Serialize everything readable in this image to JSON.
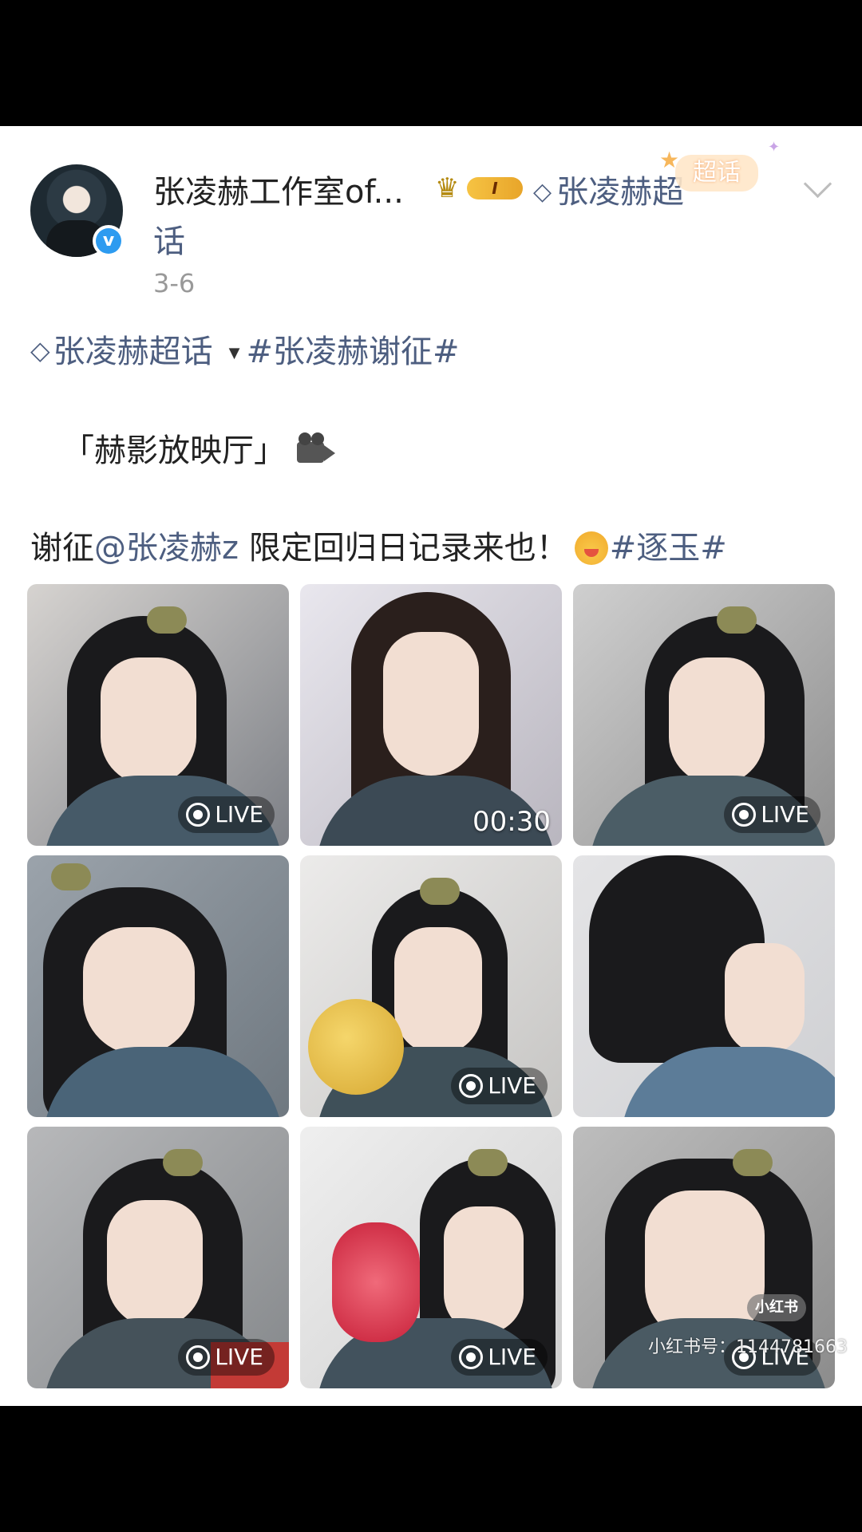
{
  "post": {
    "username_line1": "张凌赫工作室of...",
    "vip_level": "I",
    "supertopic_tag": "张凌赫超",
    "username_line2": "话",
    "sticker_text": "超话",
    "date": "3-6",
    "topic_supertopic": "张凌赫超话",
    "topic_hashtag": "#张凌赫谢征#",
    "text_line2": "「赫影放映厅」",
    "text_line3_prefix": "谢征",
    "mention": "@张凌赫z",
    "text_line3_body": " 限定回归日记录来也！",
    "hashtag2": "#逐玉#"
  },
  "grid": {
    "tiles": [
      {
        "badge": "LIVE",
        "duration": ""
      },
      {
        "badge": "",
        "duration": "00:30"
      },
      {
        "badge": "LIVE",
        "duration": ""
      },
      {
        "badge": "",
        "duration": ""
      },
      {
        "badge": "LIVE",
        "duration": ""
      },
      {
        "badge": "",
        "duration": ""
      },
      {
        "badge": "LIVE",
        "duration": ""
      },
      {
        "badge": "LIVE",
        "duration": ""
      },
      {
        "badge": "LIVE",
        "duration": ""
      }
    ]
  },
  "watermark": {
    "logo": "小红书",
    "text": "小红书号：1144781663"
  },
  "colors": {
    "link": "#4d5e80",
    "verify": "#2d9bf0"
  }
}
